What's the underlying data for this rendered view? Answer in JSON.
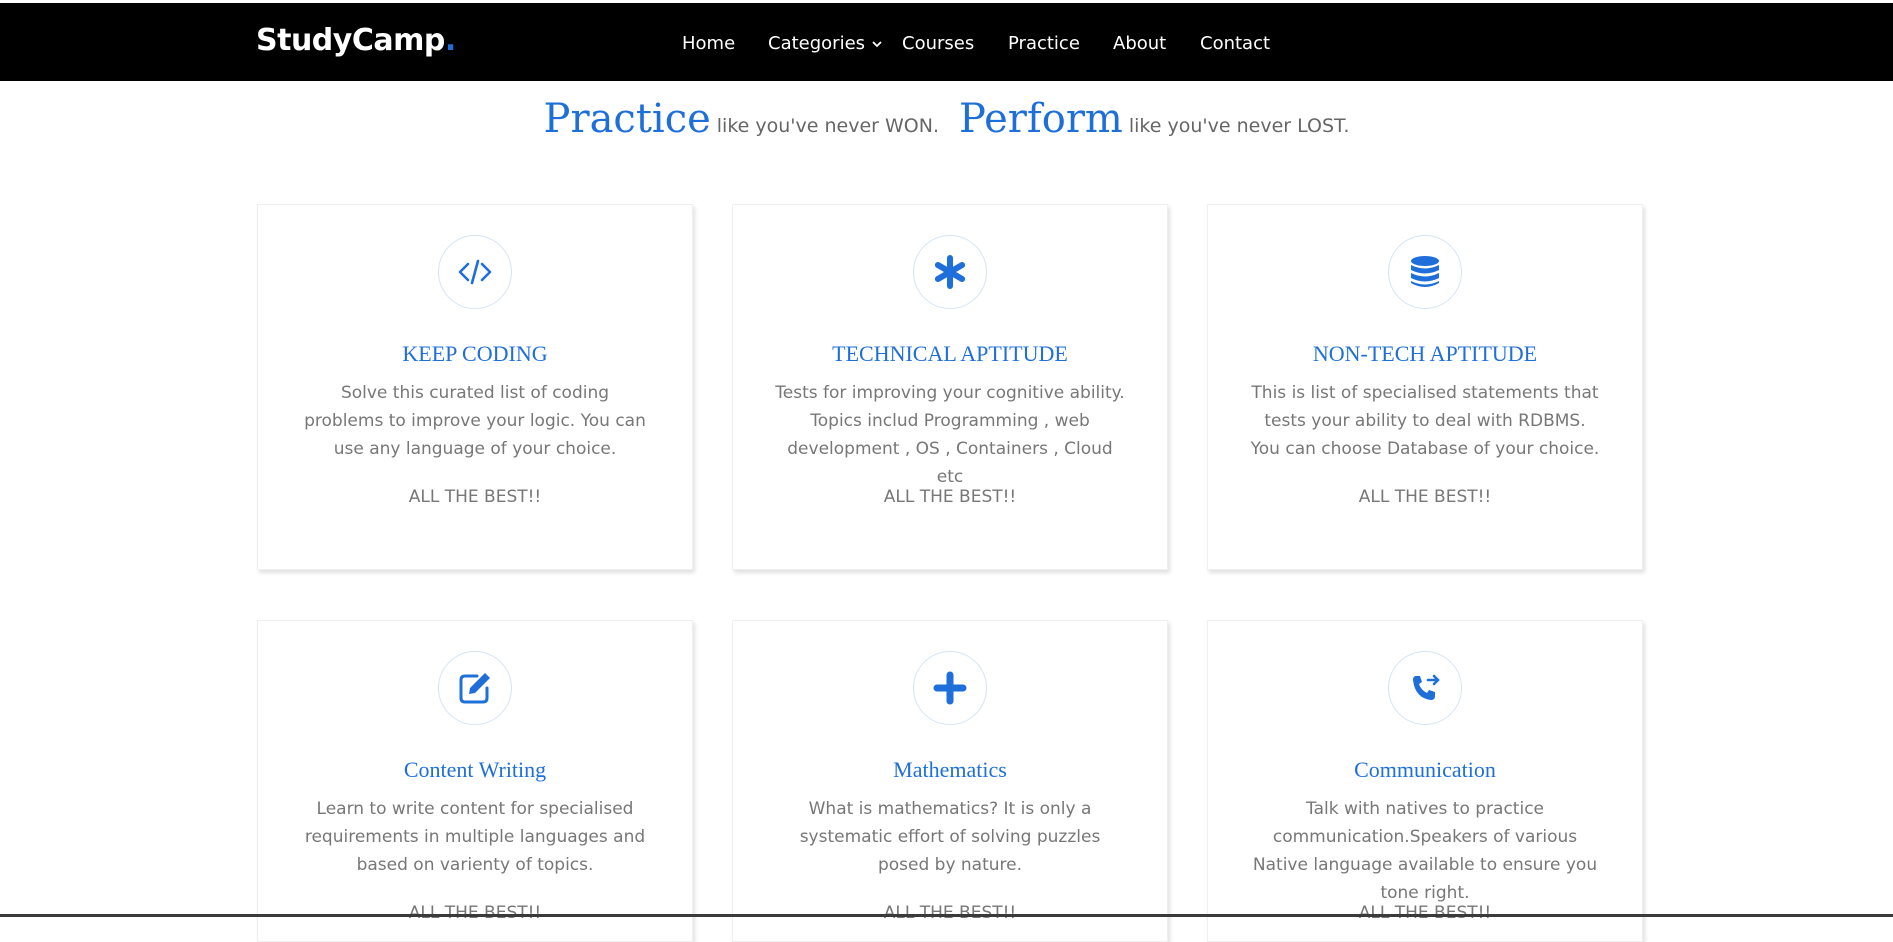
{
  "brand": {
    "name": "StudyCamp",
    "dot": "."
  },
  "nav": {
    "home": "Home",
    "categories": "Categories",
    "courses": "Courses",
    "practice": "Practice",
    "about": "About",
    "contact": "Contact"
  },
  "tagline": {
    "word1": "Practice",
    "phrase1": "like you've never WON.",
    "word2": "Perform",
    "phrase2": "like you've never LOST."
  },
  "cards": [
    {
      "icon": "code-icon",
      "title": "KEEP CODING",
      "description": "Solve this curated list of coding problems to improve your logic. You can use any language of your choice.",
      "footer": "ALL THE BEST!!"
    },
    {
      "icon": "asterisk-icon",
      "title": "TECHNICAL APTITUDE",
      "description": "Tests for improving your cognitive ability. Topics includ Programming , web development , OS , Containers , Cloud etc",
      "footer": "ALL THE BEST!!"
    },
    {
      "icon": "database-icon",
      "title": "NON-TECH APTITUDE",
      "description": "This is list of specialised statements that tests your ability to deal with RDBMS. You can choose Database of your choice.",
      "footer": "ALL THE BEST!!"
    },
    {
      "icon": "edit-icon",
      "title": "Content Writing",
      "description": "Learn to write content for specialised requirements in multiple languages and based on varienty of topics.",
      "footer": "ALL THE BEST!!"
    },
    {
      "icon": "plus-icon",
      "title": "Mathematics",
      "description": "What is mathematics? It is only a systematic effort of solving puzzles posed by nature.",
      "footer": "ALL THE BEST!!"
    },
    {
      "icon": "phone-forward-icon",
      "title": "Communication",
      "description": "Talk with natives to practice communication.Speakers of various Native language available to ensure you tone right.",
      "footer": "ALL THE BEST!!"
    }
  ],
  "colors": {
    "accent": "#1e6fd9",
    "navbar": "#000000",
    "body_text": "#777777"
  }
}
